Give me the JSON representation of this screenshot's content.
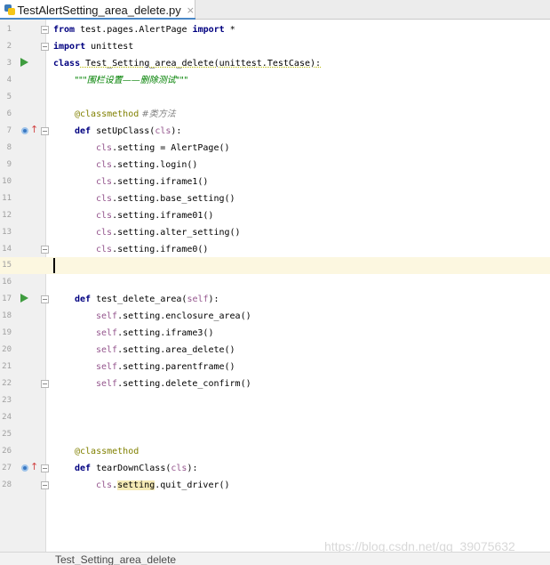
{
  "tab": {
    "filename": "TestAlertSetting_area_delete.py",
    "close": "×"
  },
  "gutter": {
    "line_numbers": [
      "1",
      "2",
      "3",
      "4",
      "5",
      "6",
      "7",
      "8",
      "9",
      "10",
      "11",
      "12",
      "13",
      "14",
      "15",
      "16",
      "17",
      "18",
      "19",
      "20",
      "21",
      "22",
      "23",
      "24",
      "25",
      "26",
      "27",
      "28"
    ]
  },
  "code": {
    "l1": {
      "kw": "from",
      "rest1": " test.pages.AlertPage ",
      "kw2": "import",
      "rest2": " *"
    },
    "l2": {
      "kw": "import",
      "rest": " unittest"
    },
    "l3": {
      "kw": "class",
      "rest": " Test_Setting_area_delete(unittest.TestCase):"
    },
    "l4": {
      "doc": "\"\"\"围栏设置——删除测试\"\"\""
    },
    "l6": {
      "deco": "@classmethod",
      "comment": " #类方法"
    },
    "l7": {
      "kw": "def",
      "rest1": " setUpClass(",
      "param": "cls",
      "rest2": "):"
    },
    "l8": {
      "self": "cls",
      "rest": ".setting = AlertPage()"
    },
    "l9": {
      "self": "cls",
      "rest": ".setting.login()"
    },
    "l10": {
      "self": "cls",
      "rest": ".setting.iframe1()"
    },
    "l11": {
      "self": "cls",
      "rest": ".setting.base_setting()"
    },
    "l12": {
      "self": "cls",
      "rest": ".setting.iframe01()"
    },
    "l13": {
      "self": "cls",
      "rest": ".setting.alter_setting()"
    },
    "l14": {
      "self": "cls",
      "rest": ".setting.iframe0()"
    },
    "l17": {
      "kw": "def",
      "rest1": " test_delete_area(",
      "param": "self",
      "rest2": "):"
    },
    "l18": {
      "self": "self",
      "rest": ".setting.enclosure_area()"
    },
    "l19": {
      "self": "self",
      "rest": ".setting.iframe3()"
    },
    "l20": {
      "self": "self",
      "rest": ".setting.area_delete()"
    },
    "l21": {
      "self": "self",
      "rest": ".setting.parentframe()"
    },
    "l22": {
      "self": "self",
      "rest": ".setting.delete_confirm()"
    },
    "l26": {
      "deco": "@classmethod"
    },
    "l27": {
      "kw": "def",
      "rest1": " tearDownClass(",
      "param": "cls",
      "rest2": "):"
    },
    "l28": {
      "self": "cls",
      "dot": ".",
      "hl": "setting",
      "rest": ".quit_driver()"
    }
  },
  "statusbar": {
    "breadcrumb": "Test_Setting_area_delete"
  },
  "watermark": "https://blog.csdn.net/qq_39075632",
  "colors": {
    "keyword": "#000080",
    "decorator": "#808000",
    "self": "#94558d",
    "docstring": "#008000",
    "comment": "#808080",
    "run_icon": "#3f9c3f",
    "current_line": "#fcf7e0"
  },
  "icons": {
    "run": "run-gutter-icon",
    "override": "overriding-method-icon",
    "fold": "fold-marker-icon",
    "file": "python-file-icon"
  }
}
